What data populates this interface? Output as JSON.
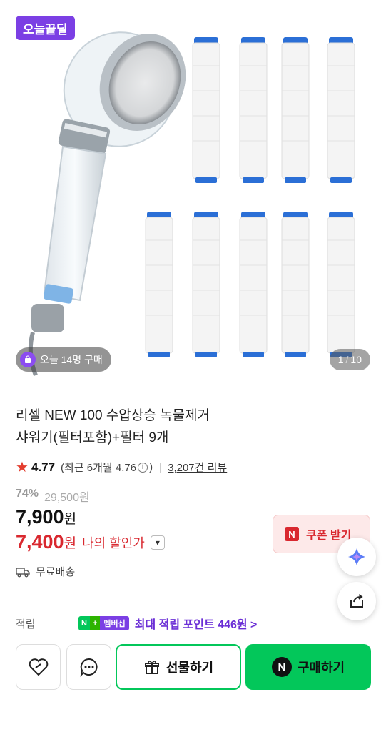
{
  "badge": {
    "label": "오늘끝딜"
  },
  "gallery": {
    "buy_count": "오늘 14명 구매",
    "current": "1",
    "total": "10"
  },
  "product": {
    "title_line1": "리셀 NEW 100 수압상승 녹물제거",
    "title_line2": "샤워기(필터포함)+필터 9개",
    "rating": "4.77",
    "recent_rating": "(최근 6개월 4.76",
    "recent_rating_close": ")",
    "reviews": "3,207건 리뷰",
    "discount_pct": "74%",
    "original_price": "29,500원",
    "price": "7,900",
    "price_unit": "원",
    "my_price": "7,400",
    "my_price_unit": "원",
    "my_price_label": "나의 할인가"
  },
  "coupon": {
    "label": "쿠폰 받기",
    "n": "N"
  },
  "shipping": {
    "label": "무료배송"
  },
  "points": {
    "label": "적립",
    "np_a": "N",
    "np_b": "+",
    "np_c": "멤버십",
    "text": "최대 적립 포인트 446원 >"
  },
  "actions": {
    "gift": "선물하기",
    "buy": "구매하기",
    "buy_n": "N"
  },
  "colors": {
    "accent_green": "#03c75a",
    "sale_red": "#d9282f",
    "purple": "#7b3fe4"
  },
  "icons": [
    "star-icon",
    "info-icon",
    "chevron-down-icon",
    "truck-icon",
    "heart-icon",
    "chat-icon",
    "gift-icon",
    "share-icon",
    "ai-assistant-icon",
    "shopping-bag-icon"
  ]
}
